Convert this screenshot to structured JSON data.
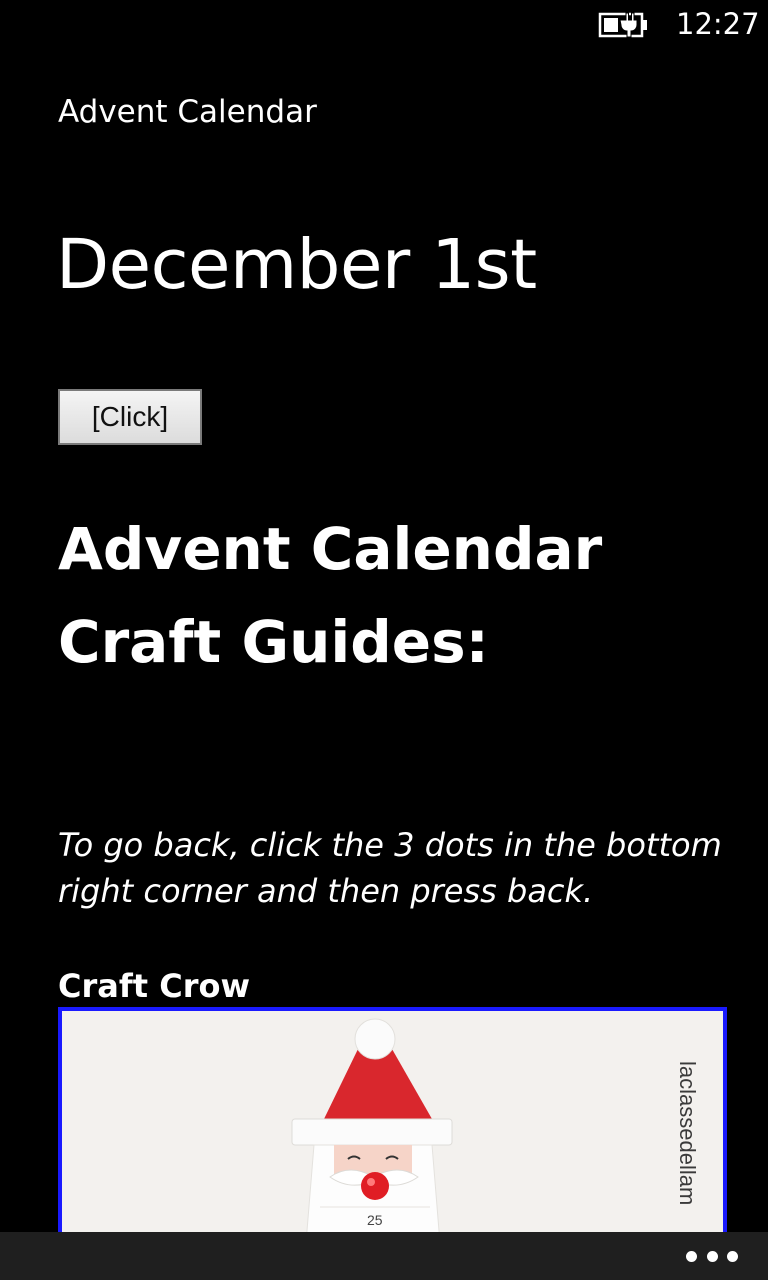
{
  "status_bar": {
    "time": "12:27",
    "battery_icon": "battery-charging-icon"
  },
  "app": {
    "title": "Advent Calendar"
  },
  "page": {
    "title": "December 1st",
    "click_button_label": "[Click]",
    "heading": "Advent Calendar Craft Guides:",
    "instructions": "To go back, click the 3 dots in the bottom right corner and then press back."
  },
  "craft": {
    "source_title": "Craft Crow",
    "image_watermark": "laclassedellam",
    "image_number": "25"
  },
  "app_bar": {
    "more_icon": "more-dots-icon"
  }
}
